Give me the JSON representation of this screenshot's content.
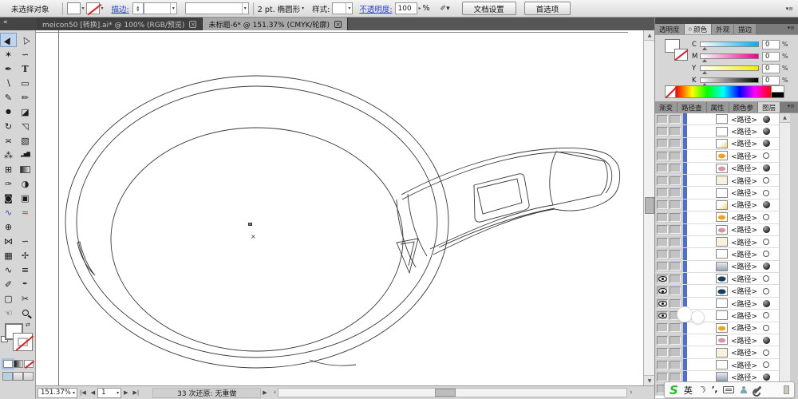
{
  "control_bar": {
    "selection_status": "未选择对象",
    "stroke_label": "描边:",
    "width_profile": "2 pt. 椭圆形",
    "style_label": "样式:",
    "opacity_label": "不透明度:",
    "opacity_value": "100",
    "opacity_unit": "%",
    "document_setup_button": "文档设置",
    "preferences_button": "首选项"
  },
  "document_tabs": [
    {
      "label": "meicon50 [转换].ai* @ 100% (RGB/预览)",
      "close": "×",
      "active": false
    },
    {
      "label": "未标题-6* @ 151.37% (CMYK/轮廓)",
      "close": "×",
      "active": true
    }
  ],
  "toolbar": {
    "collapse_icon": "«",
    "tools": [
      {
        "name": "selection-tool",
        "glyph": "▶",
        "cls": "rot-60 active"
      },
      {
        "name": "direct-selection-tool",
        "glyph": "▷",
        "cls": "rot-120"
      },
      {
        "name": "magic-wand-tool",
        "glyph": "✶",
        "cls": ""
      },
      {
        "name": "lasso-tool",
        "glyph": "∽",
        "cls": ""
      },
      {
        "name": "pen-tool",
        "glyph": "✒",
        "cls": ""
      },
      {
        "name": "type-tool",
        "glyph": "T",
        "cls": "serif"
      },
      {
        "name": "line-tool",
        "glyph": "∖",
        "cls": ""
      },
      {
        "name": "rectangle-tool",
        "glyph": "▭",
        "cls": ""
      },
      {
        "name": "paintbrush-tool",
        "glyph": "✎",
        "cls": ""
      },
      {
        "name": "pencil-tool",
        "glyph": "✏",
        "cls": ""
      },
      {
        "name": "blob-brush-tool",
        "glyph": "●",
        "cls": "small"
      },
      {
        "name": "eraser-tool",
        "glyph": "◪",
        "cls": ""
      },
      {
        "name": "rotate-tool",
        "glyph": "↻",
        "cls": ""
      },
      {
        "name": "scale-tool",
        "glyph": "◹",
        "cls": ""
      },
      {
        "name": "width-tool",
        "glyph": "≍",
        "cls": ""
      },
      {
        "name": "free-transform-tool",
        "glyph": "▧",
        "cls": ""
      },
      {
        "name": "symbol-sprayer-tool",
        "glyph": "⁂",
        "cls": ""
      },
      {
        "name": "column-graph-tool",
        "glyph": "▂▅▇",
        "cls": "bars"
      },
      {
        "name": "mesh-tool",
        "glyph": "⊞",
        "cls": ""
      },
      {
        "name": "gradient-tool",
        "glyph": "",
        "cls": "grad-box"
      },
      {
        "name": "eyedropper-tool",
        "glyph": "✑",
        "cls": ""
      },
      {
        "name": "blend-tool",
        "glyph": "◑",
        "cls": ""
      },
      {
        "name": "live-paint-bucket-tool",
        "glyph": "◙",
        "cls": ""
      },
      {
        "name": "live-paint-selection-tool",
        "glyph": "▣",
        "cls": ""
      },
      {
        "name": "shaper-tool",
        "glyph": "∿",
        "cls": "blue"
      },
      {
        "name": "curvature-tool",
        "glyph": "≈",
        "cls": "red"
      },
      {
        "name": "artboard-tool",
        "glyph": "⊕",
        "cls": ""
      },
      {
        "name": "spacer",
        "glyph": "",
        "cls": "blank"
      },
      {
        "name": "envelope-distort-tool",
        "glyph": "⋈",
        "cls": ""
      },
      {
        "name": "reshape-tool",
        "glyph": "∽",
        "cls": ""
      },
      {
        "name": "transform-grid-tool",
        "glyph": "▦",
        "cls": ""
      },
      {
        "name": "wrinkle-tool",
        "glyph": "✢",
        "cls": ""
      },
      {
        "name": "scribble-tool",
        "glyph": "∿",
        "cls": ""
      },
      {
        "name": "flatten-tool",
        "glyph": "≡",
        "cls": ""
      },
      {
        "name": "measure-tool",
        "glyph": "✐",
        "cls": ""
      },
      {
        "name": "ink-pen-tool",
        "glyph": "✒",
        "cls": "small"
      },
      {
        "name": "crop-area-tool",
        "glyph": "▢",
        "cls": ""
      },
      {
        "name": "slice-tool",
        "glyph": "✂",
        "cls": ""
      },
      {
        "name": "hand-tool",
        "glyph": "☜",
        "cls": ""
      },
      {
        "name": "zoom-tool",
        "glyph": "",
        "cls": "zoom-glyph"
      }
    ]
  },
  "right_dock": {
    "collapse_icon": "»",
    "panel_tabs_upper": [
      {
        "label": "透明度",
        "active": false,
        "marker": ""
      },
      {
        "label": "颜色",
        "active": true,
        "marker": "◇"
      },
      {
        "label": "外观",
        "active": false,
        "marker": ""
      },
      {
        "label": "描边",
        "active": false,
        "marker": ""
      }
    ],
    "color_panel": {
      "channels": [
        {
          "label": "C",
          "value": "0"
        },
        {
          "label": "M",
          "value": "0"
        },
        {
          "label": "Y",
          "value": "0"
        },
        {
          "label": "K",
          "value": "0"
        }
      ],
      "unit": "%"
    },
    "panel_tabs_lower": [
      {
        "label": "渐变",
        "active": false
      },
      {
        "label": "路径查",
        "active": false
      },
      {
        "label": "属性",
        "active": false
      },
      {
        "label": "颜色参",
        "active": false
      },
      {
        "label": "图层",
        "active": true
      }
    ],
    "layers": {
      "item_label": "<路径>",
      "rows": [
        {
          "thumb": "white",
          "target": "filled",
          "eye": false
        },
        {
          "thumb": "white",
          "target": "filled",
          "eye": false
        },
        {
          "thumb": "yellow-grad",
          "target": "filled",
          "eye": false
        },
        {
          "thumb": "orange",
          "target": "hollow",
          "eye": false
        },
        {
          "thumb": "pink",
          "target": "filled",
          "eye": false
        },
        {
          "thumb": "cream",
          "target": "hollow",
          "eye": false
        },
        {
          "thumb": "white",
          "target": "hollow",
          "eye": false
        },
        {
          "thumb": "yellow-grad",
          "target": "filled",
          "eye": false
        },
        {
          "thumb": "orange",
          "target": "hollow",
          "eye": false
        },
        {
          "thumb": "pink",
          "target": "filled",
          "eye": false
        },
        {
          "thumb": "cream",
          "target": "hollow",
          "eye": false
        },
        {
          "thumb": "white",
          "target": "hollow",
          "eye": false
        },
        {
          "thumb": "gray-grad",
          "target": "filled",
          "eye": false
        },
        {
          "thumb": "navy",
          "target": "hollow",
          "eye": true
        },
        {
          "thumb": "navy",
          "target": "hollow",
          "eye": true
        },
        {
          "thumb": "white",
          "target": "filled",
          "eye": true
        },
        {
          "thumb": "white",
          "target": "hollow",
          "eye": true
        },
        {
          "thumb": "orange",
          "target": "hollow",
          "eye": false
        },
        {
          "thumb": "pink",
          "target": "filled",
          "eye": false
        },
        {
          "thumb": "cream",
          "target": "hollow",
          "eye": false
        },
        {
          "thumb": "white",
          "target": "hollow",
          "eye": false
        },
        {
          "thumb": "gray-grad",
          "target": "filled",
          "eye": false
        },
        {
          "thumb": "pink",
          "target": "filled",
          "eye": false
        }
      ]
    }
  },
  "status_bar": {
    "zoom_level": "151.37%",
    "page_number": "1",
    "history_status": "33 次还原: 无重做"
  },
  "ime_bar": {
    "logo": "S",
    "lang_mode": "英",
    "punct": "’,"
  },
  "colors": {
    "layer_selection_bar": "#4f6fd0",
    "link_blue": "#2a43c8",
    "ime_green": "#2fb82f",
    "tool_highlight": "#bcd4ee"
  }
}
